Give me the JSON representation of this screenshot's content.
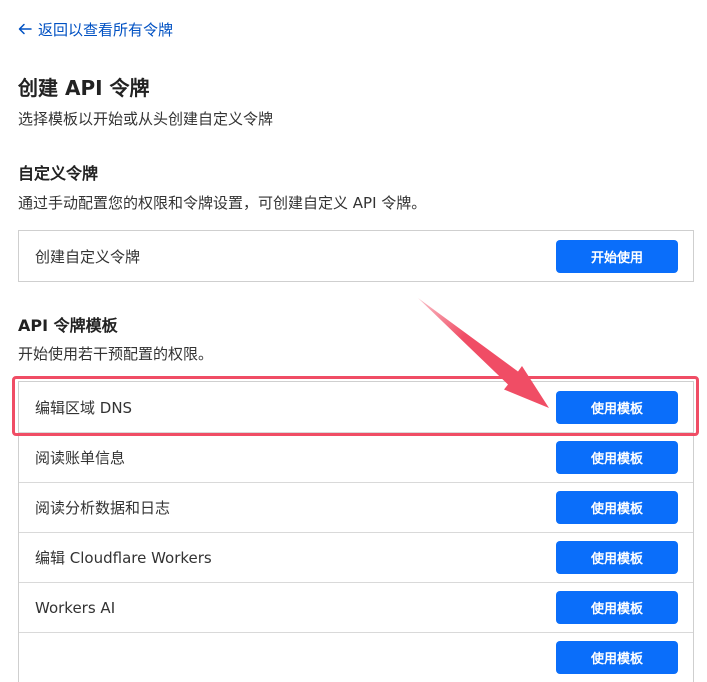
{
  "nav": {
    "back_label": "返回以查看所有令牌"
  },
  "header": {
    "title": "创建 API 令牌",
    "subtitle": "选择模板以开始或从头创建自定义令牌"
  },
  "custom_section": {
    "title": "自定义令牌",
    "description": "通过手动配置您的权限和令牌设置，可创建自定义 API 令牌。",
    "row_label": "创建自定义令牌",
    "button_label": "开始使用"
  },
  "templates_section": {
    "title": "API 令牌模板",
    "description": "开始使用若干预配置的权限。",
    "templates": [
      {
        "label": "编辑区域 DNS",
        "button_label": "使用模板"
      },
      {
        "label": "阅读账单信息",
        "button_label": "使用模板"
      },
      {
        "label": "阅读分析数据和日志",
        "button_label": "使用模板"
      },
      {
        "label": "编辑 Cloudflare Workers",
        "button_label": "使用模板"
      },
      {
        "label": "Workers AI",
        "button_label": "使用模板"
      },
      {
        "label": "",
        "button_label": "使用模板"
      }
    ]
  },
  "annotation": {
    "color": "#f04d65",
    "highlighted_template": "编辑区域 DNS"
  },
  "colors": {
    "link": "#0051c3",
    "button": "#0a6efa",
    "button_text": "#ffffff"
  }
}
